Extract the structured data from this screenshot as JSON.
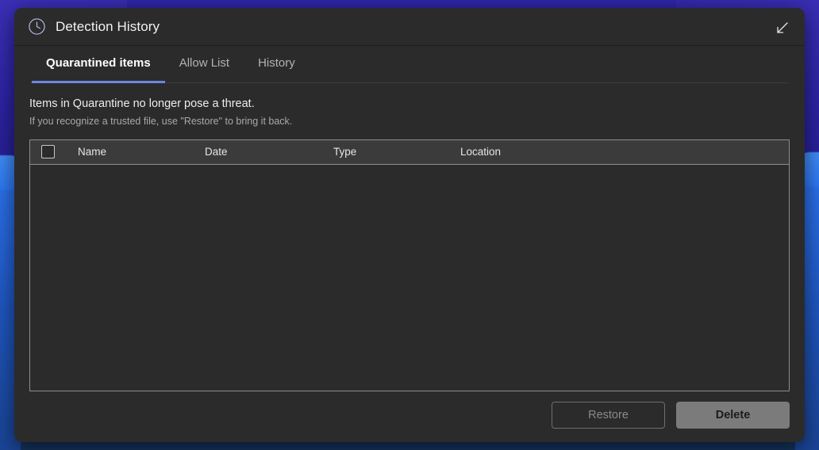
{
  "window": {
    "title": "Detection History",
    "title_icon": "clock-icon",
    "collapse_icon": "arrow-down-left-icon"
  },
  "tabs": [
    {
      "label": "Quarantined items",
      "active": true
    },
    {
      "label": "Allow List",
      "active": false
    },
    {
      "label": "History",
      "active": false
    }
  ],
  "description": {
    "primary": "Items in Quarantine no longer pose a threat.",
    "secondary": "If you recognize a trusted file, use \"Restore\" to bring it back."
  },
  "table": {
    "select_all_checked": false,
    "columns": [
      "Name",
      "Date",
      "Type",
      "Location"
    ],
    "rows": []
  },
  "footer": {
    "restore_label": "Restore",
    "delete_label": "Delete"
  },
  "colors": {
    "accent": "#6a87e0",
    "window_bg": "#2b2b2b",
    "table_header_bg": "#3b3b3b",
    "delete_button_bg": "#7b7b7b",
    "wallpaper_violet": "#2e26a8",
    "wallpaper_blue": "#2a6fe8"
  }
}
